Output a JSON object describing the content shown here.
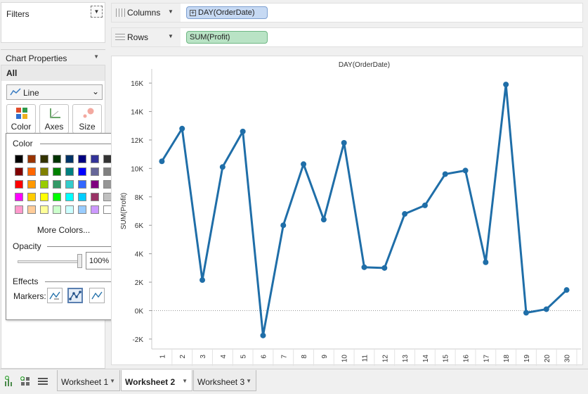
{
  "filters": {
    "title": "Filters"
  },
  "chart_properties": {
    "title": "Chart Properties",
    "all_label": "All",
    "mark_type": "Line",
    "buttons": {
      "color": "Color",
      "axes": "Axes",
      "size": "Size"
    }
  },
  "color_popup": {
    "color_title": "Color",
    "swatches": [
      [
        "#000000",
        "#993300",
        "#333300",
        "#003300",
        "#003366",
        "#000080",
        "#333399",
        "#333333"
      ],
      [
        "#800000",
        "#ff6600",
        "#808000",
        "#008000",
        "#008080",
        "#0000ff",
        "#666699",
        "#808080"
      ],
      [
        "#ff0000",
        "#ff9900",
        "#99cc00",
        "#339966",
        "#33cccc",
        "#3366ff",
        "#800080",
        "#969696"
      ],
      [
        "#ff00ff",
        "#ffcc00",
        "#ffff00",
        "#00ff00",
        "#00ffff",
        "#00ccff",
        "#993366",
        "#c0c0c0"
      ],
      [
        "#ff99cc",
        "#ffcc99",
        "#ffff99",
        "#ccffcc",
        "#ccffff",
        "#99ccff",
        "#cc99ff",
        "#ffffff"
      ]
    ],
    "more_colors": "More Colors...",
    "opacity_title": "Opacity",
    "opacity_value": "100%",
    "opacity_level": 1.0,
    "effects_title": "Effects",
    "markers_label": "Markers:",
    "markers_selected": "all-points"
  },
  "shelves": {
    "columns": {
      "label": "Columns",
      "pill": "DAY(OrderDate)"
    },
    "rows": {
      "label": "Rows",
      "pill": "SUM(Profit)"
    }
  },
  "chart_data": {
    "type": "line",
    "title": "DAY(OrderDate)",
    "xlabel": "",
    "ylabel": "SUM(Profit)",
    "categories": [
      "1",
      "2",
      "3",
      "4",
      "5",
      "6",
      "7",
      "8",
      "9",
      "10",
      "11",
      "12",
      "13",
      "14",
      "15",
      "16",
      "17",
      "18",
      "19",
      "20",
      "30"
    ],
    "series": [
      {
        "values": [
          10500,
          12800,
          2150,
          10100,
          12600,
          -1750,
          6000,
          10300,
          6400,
          11800,
          3050,
          3000,
          6800,
          7400,
          9600,
          9850,
          3400,
          15900,
          -150,
          100,
          1450
        ]
      }
    ],
    "yticks": [
      -2000,
      0,
      2000,
      4000,
      6000,
      8000,
      10000,
      12000,
      14000,
      16000
    ],
    "ytick_labels": [
      "-2K",
      "0K",
      "2K",
      "4K",
      "6K",
      "8K",
      "10K",
      "12K",
      "14K",
      "16K"
    ],
    "ylim": [
      -2500,
      16500
    ],
    "color": "#1f6ea8",
    "zero_line": "dotted",
    "grid": false
  },
  "sheet_tabs": [
    {
      "label": "Worksheet 1",
      "active": false
    },
    {
      "label": "Worksheet 2",
      "active": true
    },
    {
      "label": "Worksheet 3",
      "active": false
    }
  ]
}
